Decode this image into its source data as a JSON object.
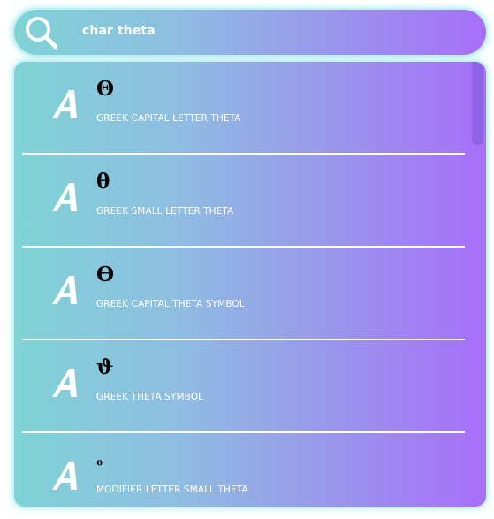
{
  "search": {
    "query": "char theta",
    "icon": "search-icon"
  },
  "results": [
    {
      "glyph": "Θ",
      "name": "GREEK CAPITAL LETTER THETA",
      "icon": "font-a-icon"
    },
    {
      "glyph": "θ",
      "name": "GREEK SMALL LETTER THETA",
      "icon": "font-a-icon"
    },
    {
      "glyph": "ϴ",
      "name": "GREEK CAPITAL THETA SYMBOL",
      "icon": "font-a-icon"
    },
    {
      "glyph": "ϑ",
      "name": "GREEK THETA SYMBOL",
      "icon": "font-a-icon"
    },
    {
      "glyph": "ᶿ",
      "name": "MODIFIER LETTER SMALL THETA",
      "icon": "font-a-icon"
    }
  ],
  "colors": {
    "gradient_start": "#7fd3d6",
    "gradient_end": "#a86ef8",
    "glow": "#8fe6eb",
    "scrollbar": "#8e62e6"
  }
}
